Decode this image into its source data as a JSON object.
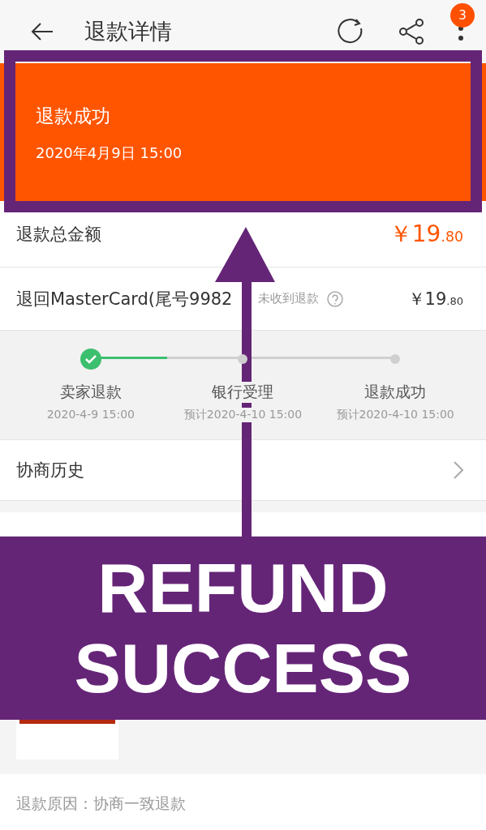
{
  "header": {
    "title": "退款详情",
    "badge": "3"
  },
  "status": {
    "title": "退款成功",
    "time": "2020年4月9日 15:00"
  },
  "total": {
    "label": "退款总金额",
    "currency": "￥",
    "amount_main": "19",
    "amount_decimal": ".80"
  },
  "card_row": {
    "label": "退回MasterCard(尾号9982",
    "hint": "未收到退款",
    "currency": "￥",
    "amount_main": "19",
    "amount_decimal": ".80"
  },
  "progress": {
    "level": 0.25,
    "steps": [
      {
        "label": "卖家退款",
        "time": "2020-4-9 15:00",
        "done": true
      },
      {
        "label": "银行受理",
        "time": "预计2020-4-10 15:00",
        "done": false
      },
      {
        "label": "退款成功",
        "time": "预计2020-4-10 15:00",
        "done": false
      }
    ]
  },
  "history": {
    "label": "协商历史"
  },
  "reason": {
    "text": "退款原因：协商一致退款"
  },
  "annotation": {
    "caption_lines": [
      "REFUND",
      "SUCCESS"
    ]
  }
}
